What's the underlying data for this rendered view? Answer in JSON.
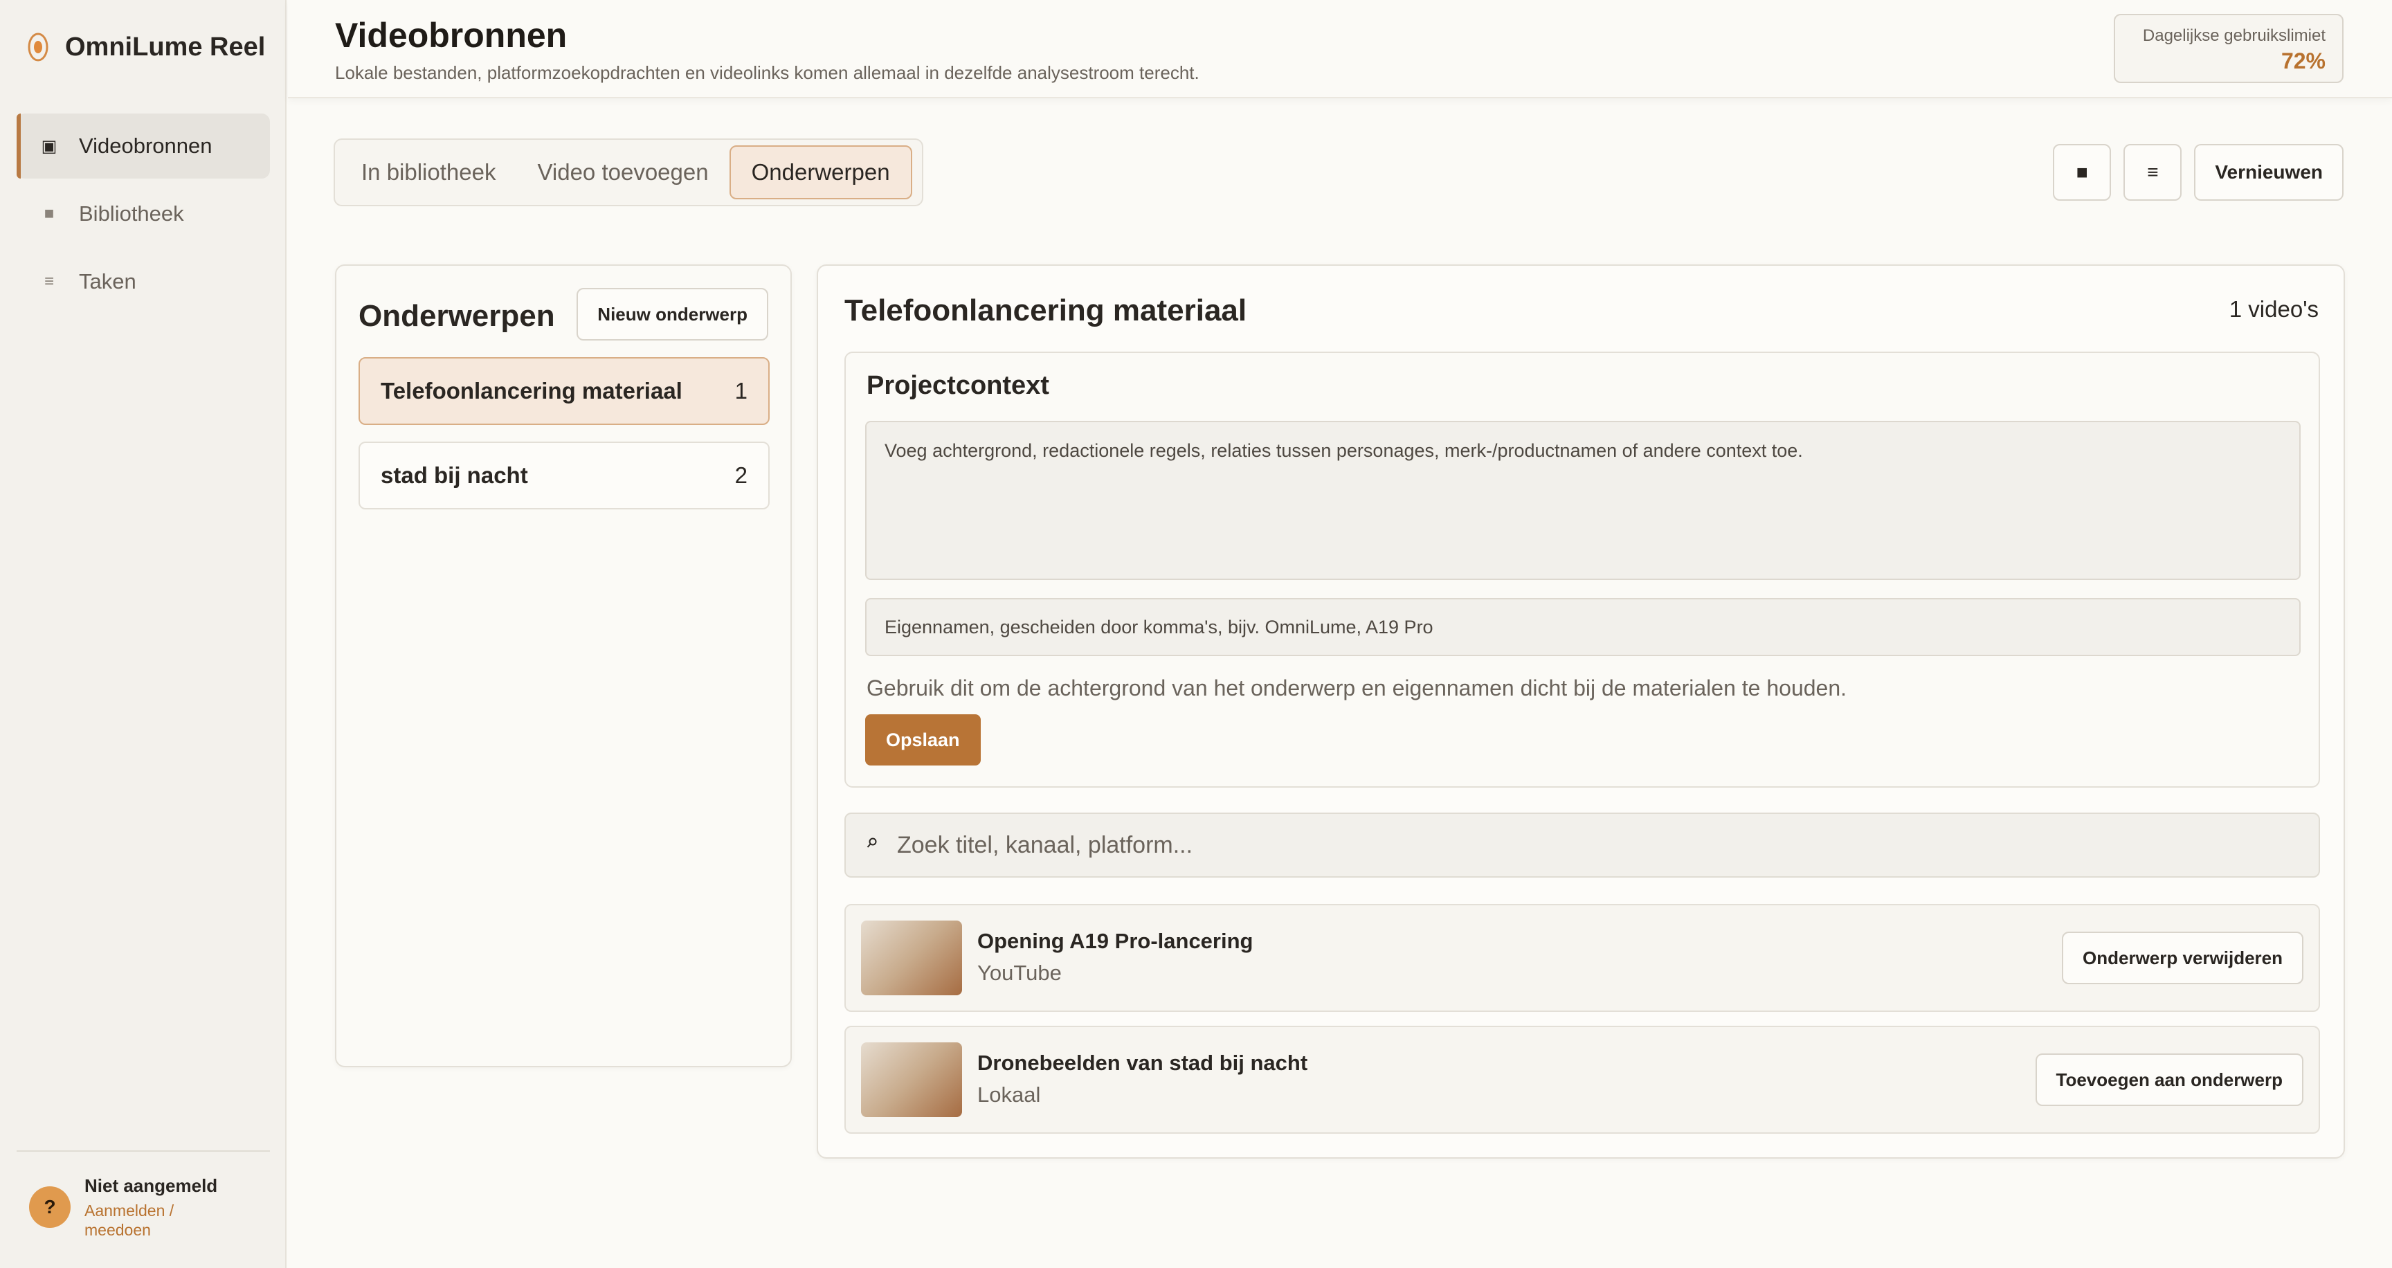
{
  "app": {
    "name": "OmniLume Reel",
    "logo_icon": "omnilume-logo-icon"
  },
  "sidebar": {
    "items": [
      {
        "label": "Videobronnen",
        "icon": "screen-icon",
        "glyph": "▣",
        "active": true
      },
      {
        "label": "Bibliotheek",
        "icon": "square-icon",
        "glyph": "■",
        "active": false
      },
      {
        "label": "Taken",
        "icon": "menu-icon",
        "glyph": "≡",
        "active": false
      }
    ],
    "user": {
      "avatar": "?",
      "status": "Niet aangemeld",
      "link": "Aanmelden / meedoen"
    }
  },
  "header": {
    "title": "Videobronnen",
    "subtitle": "Lokale bestanden, platformzoekopdrachten en videolinks komen allemaal in dezelfde analysestroom terecht.",
    "usage_label": "Dagelijkse gebruikslimiet",
    "usage_value": "72%",
    "usage_fraction": 0.72
  },
  "tabs": [
    {
      "label": "In bibliotheek",
      "active": false
    },
    {
      "label": "Video toevoegen",
      "active": false
    },
    {
      "label": "Onderwerpen",
      "active": true
    }
  ],
  "toolbar": {
    "grid_glyph": "■",
    "list_glyph": "≡",
    "refresh_label": "Vernieuwen"
  },
  "topics": {
    "title": "Onderwerpen",
    "new_label": "Nieuw onderwerp",
    "items": [
      {
        "name": "Telefoonlancering materiaal",
        "count": "1",
        "active": true
      },
      {
        "name": "stad bij nacht",
        "count": "2",
        "active": false
      }
    ]
  },
  "detail": {
    "title": "Telefoonlancering materiaal",
    "count": "1 video's",
    "context": {
      "title": "Projectcontext",
      "textarea_placeholder": "Voeg achtergrond, redactionele regels, relaties tussen personages, merk-/productnamen of andere context toe.",
      "names_placeholder": "Eigennamen, gescheiden door komma's, bijv. OmniLume, A19 Pro",
      "hint": "Gebruik dit om de achtergrond van het onderwerp en eigennamen dicht bij de materialen te houden.",
      "save_label": "Opslaan"
    },
    "search_placeholder": "Zoek titel, kanaal, platform...",
    "videos": [
      {
        "title": "Opening A19 Pro-lancering",
        "source": "YouTube",
        "action": "Onderwerp verwijderen"
      },
      {
        "title": "Dronebeelden van stad bij nacht",
        "source": "Lokaal",
        "action": "Toevoegen aan onderwerp"
      }
    ]
  },
  "colors": {
    "accent": "#b87436",
    "accent_soft": "#f6e8dc",
    "usage": "#b8722f"
  }
}
